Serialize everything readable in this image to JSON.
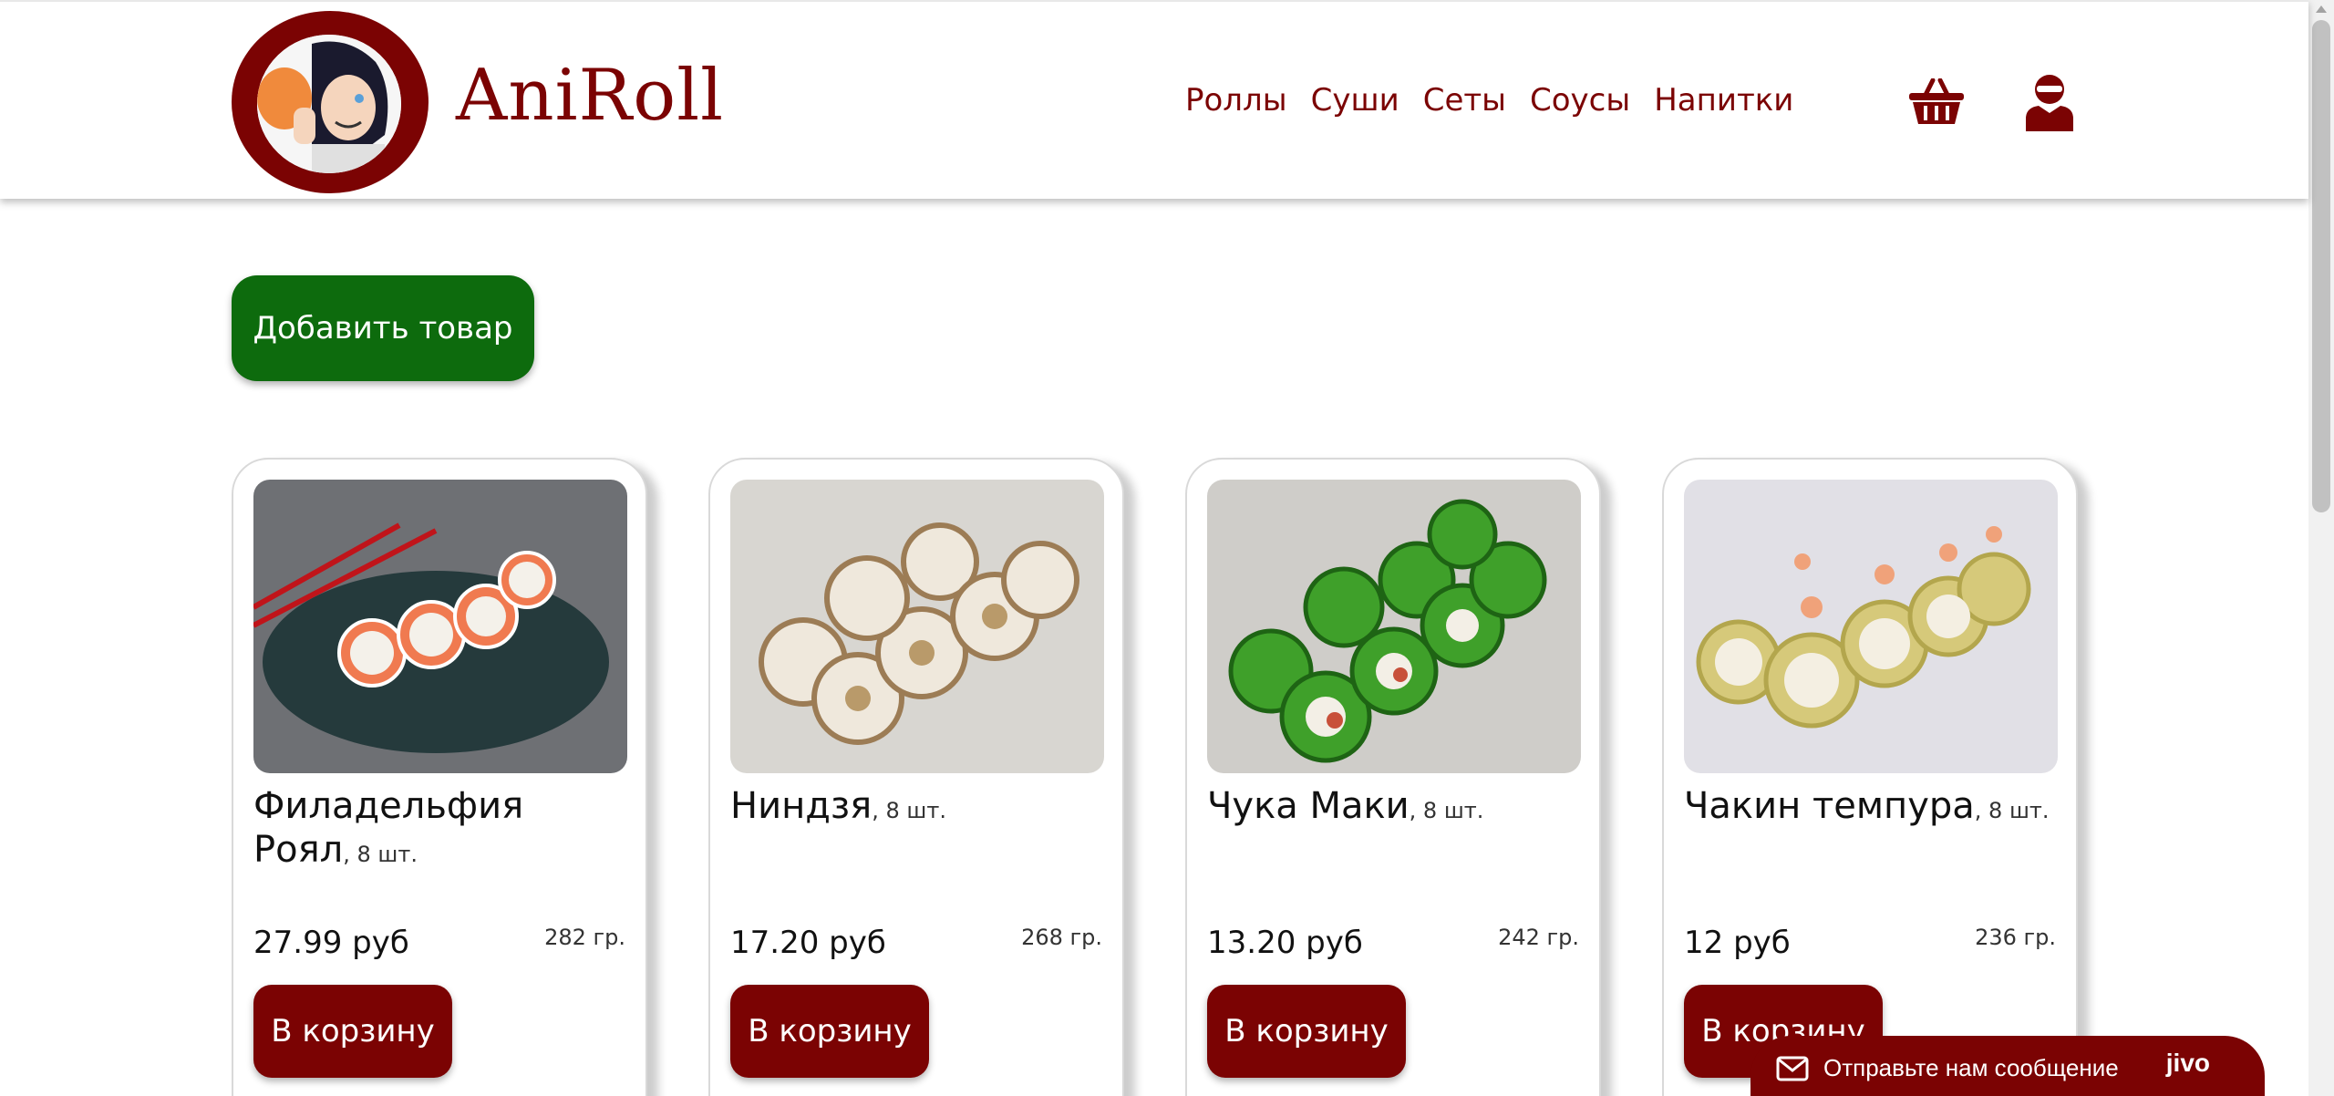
{
  "header": {
    "brand": "AniRoll",
    "nav": [
      "Роллы",
      "Суши",
      "Сеты",
      "Соусы",
      "Напитки"
    ],
    "cart_icon": "basket-icon",
    "user_icon": "ninja-user-icon"
  },
  "actions": {
    "add_product": "Добавить товар"
  },
  "products": [
    {
      "name": "Филадельфия Роял",
      "count": ", 8 шт.",
      "price": "27.99 руб",
      "weight": "282 гр.",
      "buy": "В корзину"
    },
    {
      "name": "Ниндзя",
      "count": ", 8 шт.",
      "price": "17.20 руб",
      "weight": "268 гр.",
      "buy": "В корзину"
    },
    {
      "name": "Чука Маки",
      "count": ", 8 шт.",
      "price": "13.20 руб",
      "weight": "242 гр.",
      "buy": "В корзину"
    },
    {
      "name": "Чакин темпура",
      "count": ", 8 шт.",
      "price": "12 руб",
      "weight": "236 гр.",
      "buy": "В корзину"
    }
  ],
  "chat": {
    "label": "Отправьте нам сообщение",
    "brand": "jivo"
  },
  "colors": {
    "brand_red": "#7b0303",
    "add_green": "#0d6b0d"
  }
}
